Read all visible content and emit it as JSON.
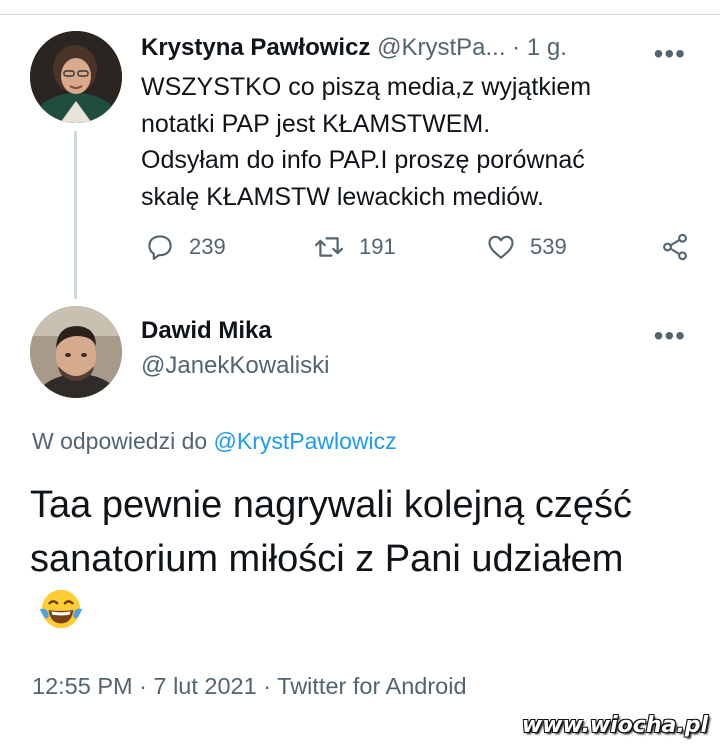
{
  "tweet1": {
    "author_name": "Krystyna Pawłowicz",
    "author_handle": "@KrystPa...",
    "separator": "·",
    "time": "1 g.",
    "text": "WSZYSTKO co piszą media,z wyjątkiem\nnotatki PAP jest KŁAMSTWEM.\nOdsyłam do info PAP.I proszę porównać\nskalę KŁAMSTW lewackich mediów.",
    "more": "•••",
    "replies": "239",
    "retweets": "191",
    "likes": "539"
  },
  "tweet2": {
    "author_name": "Dawid Mika",
    "author_handle": "@JanekKowaliski",
    "more": "•••",
    "reply_prefix": "W odpowiedzi do",
    "reply_handle": "@KrystPawlowicz",
    "text": "Taa pewnie nagrywali kolejną część sanatorium miłości z Pani udziałem",
    "emoji": "face-with-tears-of-joy",
    "timestamp": "12:55 PM · 7 lut 2021 · Twitter for Android"
  },
  "watermark": "www.wiocha.pl",
  "colors": {
    "text": "#0f1419",
    "muted": "#536471",
    "link": "#1d9bf0",
    "divider": "#cfd9de"
  }
}
